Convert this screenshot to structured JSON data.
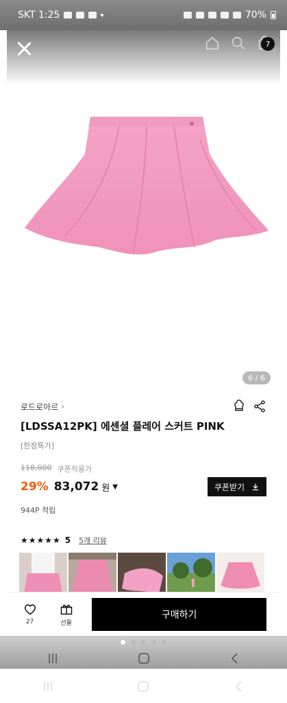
{
  "status_bar": {
    "carrier_time": "SKT 1:25",
    "battery": "70%"
  },
  "gallery": {
    "page_indicator": "6 / 6",
    "cart_count": "7"
  },
  "product": {
    "brand": "로드로아르",
    "title": "[LDSSA12PK] 에센셜 플레어 스커트 PINK",
    "tag": "[한정특가]",
    "original_price": "118,000",
    "coupon_label": "쿠폰적용가",
    "discount": "29%",
    "final_price": "83,072",
    "currency": "원",
    "coupon_button": "쿠폰받기",
    "points": "944P 적립",
    "stars": "★★★★★",
    "rating": "5",
    "review_link": "5개 리뷰"
  },
  "bottom_bar": {
    "like_count": "27",
    "gift_label": "선물",
    "buy_label": "구매하기"
  },
  "colors": {
    "discount": "#f25c05",
    "skirt_pink": "#f29cc0"
  }
}
